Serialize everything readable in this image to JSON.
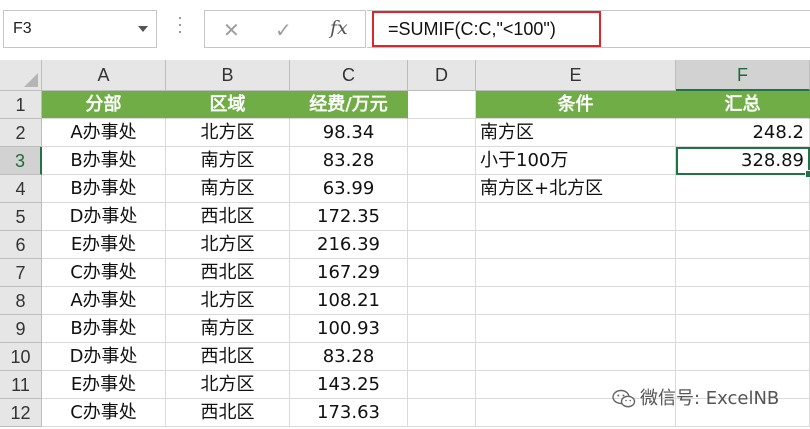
{
  "name_box": {
    "value": "F3"
  },
  "formula_bar": {
    "cancel_glyph": "✕",
    "enter_glyph": "✓",
    "fx_label": "fx",
    "formula": "=SUMIF(C:C,\"<100\")"
  },
  "columns": [
    "A",
    "B",
    "C",
    "D",
    "E",
    "F"
  ],
  "rows": [
    "1",
    "2",
    "3",
    "4",
    "5",
    "6",
    "7",
    "8",
    "9",
    "10",
    "11",
    "12"
  ],
  "selected": {
    "column": "F",
    "row": "3"
  },
  "table": {
    "headers": [
      "分部",
      "区域",
      "经费/万元"
    ],
    "data": [
      [
        "A办事处",
        "北方区",
        "98.34"
      ],
      [
        "B办事处",
        "南方区",
        "83.28"
      ],
      [
        "B办事处",
        "南方区",
        "63.99"
      ],
      [
        "D办事处",
        "西北区",
        "172.35"
      ],
      [
        "E办事处",
        "北方区",
        "216.39"
      ],
      [
        "C办事处",
        "西北区",
        "167.29"
      ],
      [
        "A办事处",
        "北方区",
        "108.21"
      ],
      [
        "B办事处",
        "南方区",
        "100.93"
      ],
      [
        "D办事处",
        "西北区",
        "83.28"
      ],
      [
        "E办事处",
        "北方区",
        "143.25"
      ],
      [
        "C办事处",
        "西北区",
        "173.63"
      ]
    ]
  },
  "summary": {
    "headers": [
      "条件",
      "汇总"
    ],
    "rows": [
      [
        "南方区",
        "248.2"
      ],
      [
        "小于100万",
        "328.89"
      ],
      [
        "南方区+北方区",
        ""
      ]
    ]
  },
  "watermark": {
    "text": "微信号: ExcelNB",
    "icon": "wechat-icon"
  },
  "colors": {
    "header_green": "#70ad47",
    "selection_green": "#217346",
    "formula_highlight": "#d9272d"
  }
}
